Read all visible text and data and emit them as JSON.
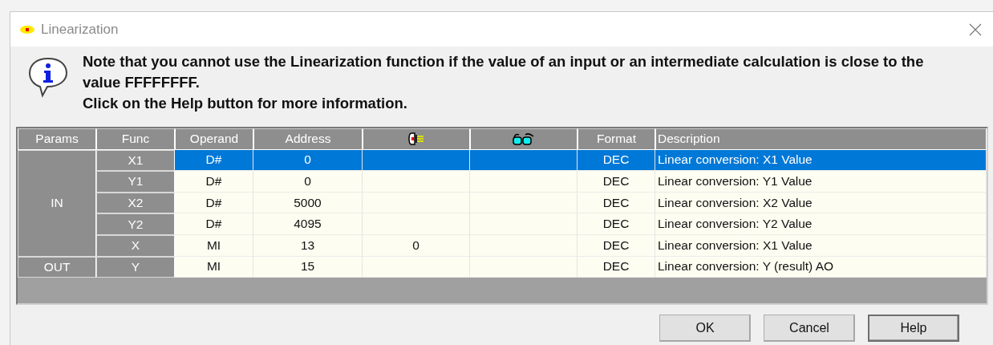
{
  "window": {
    "title": "Linearization"
  },
  "note": {
    "paragraphs": [
      "Note that you cannot use the Linearization function if the value of an input or an intermediate calculation is close to the value FFFFFFFF.",
      "Click on the Help button for more information."
    ]
  },
  "table": {
    "columns": [
      {
        "kind": "text",
        "label": "Params"
      },
      {
        "kind": "text",
        "label": "Func"
      },
      {
        "kind": "text",
        "label": "Operand"
      },
      {
        "kind": "text",
        "label": "Address"
      },
      {
        "kind": "plug"
      },
      {
        "kind": "glasses"
      },
      {
        "kind": "text",
        "label": "Format"
      },
      {
        "kind": "text",
        "label": "Description"
      }
    ],
    "groups": [
      {
        "params": "IN",
        "rows": [
          {
            "func": "X1",
            "operand": "D#",
            "address": "0",
            "format": "DEC",
            "description": "Linear conversion: X1 Value",
            "selected": true
          },
          {
            "func": "Y1",
            "operand": "D#",
            "address": "0",
            "format": "DEC",
            "description": "Linear conversion: Y1 Value",
            "selected": false
          },
          {
            "func": "X2",
            "operand": "D#",
            "address": "5000",
            "format": "DEC",
            "description": "Linear conversion: X2 Value",
            "selected": false
          },
          {
            "func": "Y2",
            "operand": "D#",
            "address": "4095",
            "format": "DEC",
            "description": "Linear conversion: Y2 Value",
            "selected": false
          },
          {
            "func": "X",
            "operand": "MI",
            "address": "13",
            "column_5": "0",
            "format": "DEC",
            "description": "Linear conversion: X1 Value",
            "selected": false
          }
        ]
      },
      {
        "params": "OUT",
        "rows": [
          {
            "func": "Y",
            "operand": "MI",
            "address": "15",
            "format": "DEC",
            "description": "Linear conversion: Y (result) AO",
            "selected": false
          }
        ]
      }
    ]
  },
  "buttons": [
    {
      "label": "OK",
      "default": false
    },
    {
      "label": "Cancel",
      "default": false
    },
    {
      "label": "Help",
      "default": true
    }
  ]
}
